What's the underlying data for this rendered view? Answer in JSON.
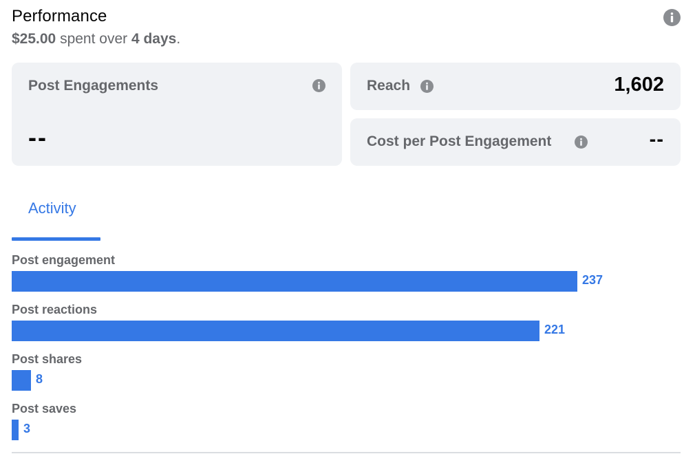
{
  "header": {
    "title": "Performance",
    "spent_amount": "$25.00",
    "spent_text": " spent over ",
    "days": "4 days",
    "period": "."
  },
  "metrics": {
    "engagements": {
      "label": "Post Engagements",
      "value": "--"
    },
    "reach": {
      "label": "Reach",
      "value": "1,602"
    },
    "cost": {
      "label": "Cost per Post Engagement",
      "value": "--"
    }
  },
  "tabs": [
    {
      "label": "Activity",
      "active": true
    }
  ],
  "chart_data": {
    "type": "bar",
    "orientation": "horizontal",
    "categories": [
      "Post engagement",
      "Post reactions",
      "Post shares",
      "Post saves"
    ],
    "values": [
      237,
      221,
      8,
      3
    ],
    "data_labels": [
      "237",
      "221",
      "8",
      "3"
    ],
    "bar_color": "#3578e5"
  },
  "colors": {
    "accent": "#3578e5",
    "muted_text": "#65676b",
    "card_bg": "#f0f2f5",
    "info_icon": "#8a8d91"
  },
  "icons": {
    "header_info": "info-icon",
    "card_info": "info-icon"
  }
}
